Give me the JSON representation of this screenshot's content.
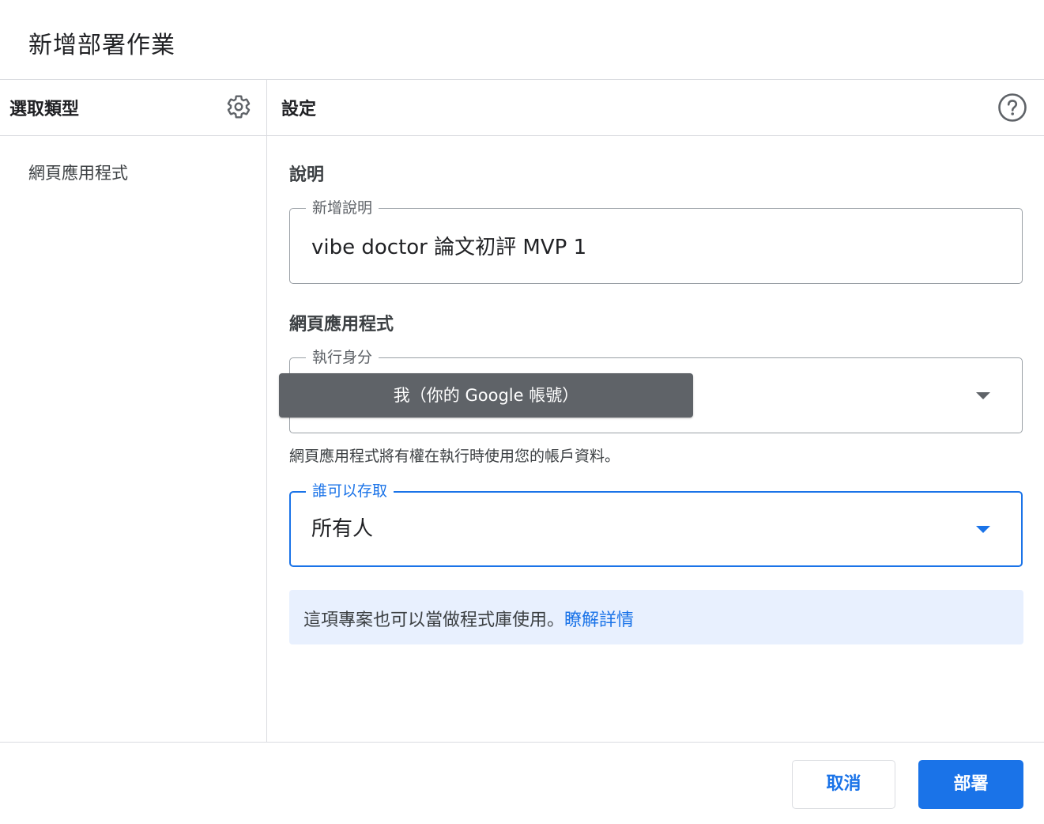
{
  "dialog": {
    "title": "新增部署作業"
  },
  "left_panel": {
    "header": "選取類型",
    "settings_icon": "gear-icon",
    "items": [
      {
        "label": "網頁應用程式"
      }
    ]
  },
  "right_panel": {
    "header": "設定",
    "help_icon": "help-circle-icon",
    "description_section": {
      "title": "說明",
      "field_label": "新增說明",
      "field_value": "vibe doctor 論文初評 MVP 1"
    },
    "webapp_section": {
      "title": "網頁應用程式",
      "execute_as": {
        "label": "執行身分",
        "tooltip": "我（你的 Google 帳號）"
      },
      "helper_text": "網頁應用程式將有權在執行時使用您的帳戶資料。",
      "who_has_access": {
        "label": "誰可以存取",
        "value": "所有人"
      }
    },
    "info_banner": {
      "text": "這項專案也可以當做程式庫使用。",
      "link": "瞭解詳情"
    }
  },
  "footer": {
    "cancel_label": "取消",
    "deploy_label": "部署"
  },
  "colors": {
    "accent": "#1a73e8",
    "info_background": "#e8f0fe",
    "tooltip_background": "#5f6368",
    "divider": "#dadce0"
  }
}
